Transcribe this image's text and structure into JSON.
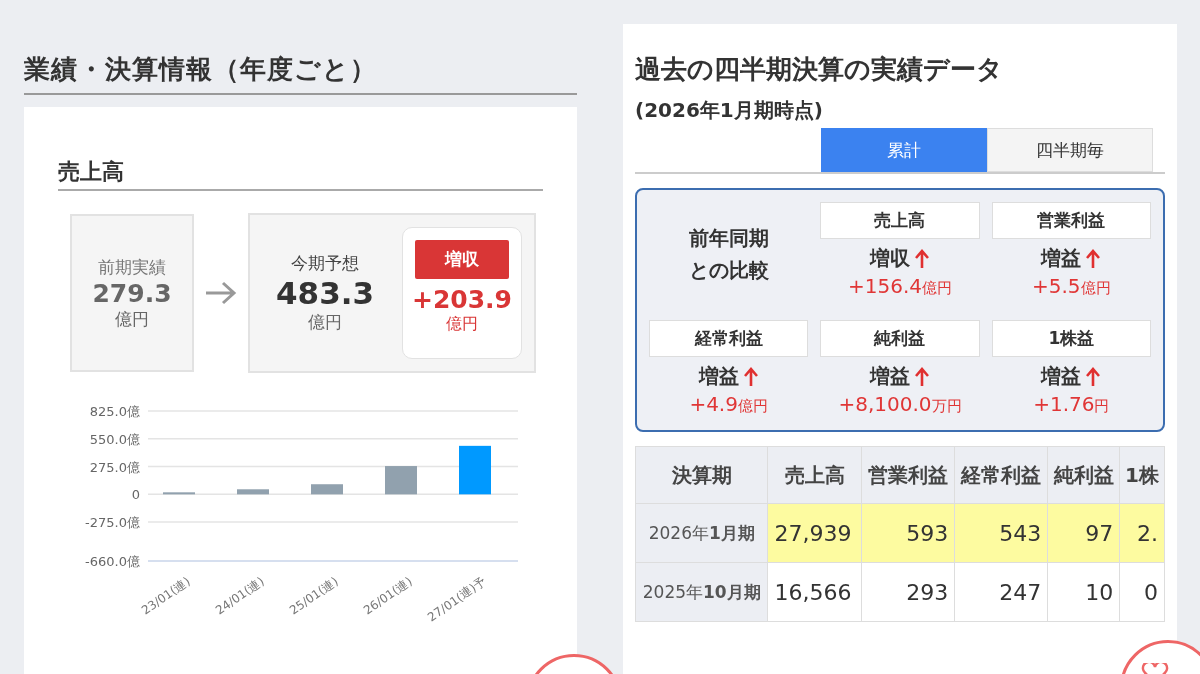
{
  "left": {
    "heading": "業績・決算情報（年度ごと）",
    "card": {
      "title": "売上高",
      "previous": {
        "label": "前期実績",
        "value": "279.3",
        "unit": "億円"
      },
      "forecast": {
        "label": "今期予想",
        "value": "483.3",
        "unit": "億円"
      },
      "change": {
        "badge": "増収",
        "value": "+203.9",
        "unit": "億円"
      },
      "chart_data": {
        "type": "bar",
        "categories": [
          "23/01(連)",
          "24/01(連)",
          "25/01(連)",
          "26/01(連)",
          "27/01(連)予"
        ],
        "series": [
          {
            "color": "#91a1ae",
            "values": [
              20,
              50,
              100,
              280,
              null
            ]
          },
          {
            "color": "#0099ff",
            "values": [
              null,
              null,
              null,
              null,
              480
            ]
          }
        ],
        "stacked": true,
        "grid": true,
        "ylim": [
          -660,
          825
        ],
        "yticks": [
          {
            "value": 825,
            "label": "825.0億"
          },
          {
            "value": 550,
            "label": "550.0億"
          },
          {
            "value": 275,
            "label": "275.0億"
          },
          {
            "value": 0,
            "label": "0"
          },
          {
            "value": -275,
            "label": "-275.0億"
          },
          {
            "value": -660,
            "label": "-660.0億"
          }
        ]
      }
    }
  },
  "right": {
    "heading": "過去の四半期決算の実績データ",
    "subheading": "(2026年1月期時点)",
    "tabs": [
      {
        "label": "累計",
        "selected": true
      },
      {
        "label": "四半期毎",
        "selected": false
      }
    ],
    "comparison": {
      "title": "前年同期との比較",
      "rows": [
        {
          "items": [
            {
              "label": "売上高",
              "result": "増収",
              "value": "+156.4",
              "unit": "億円"
            },
            {
              "label": "営業利益",
              "result": "増益",
              "value": "+5.5",
              "unit": "億円"
            }
          ]
        },
        {
          "items": [
            {
              "label": "経常利益",
              "result": "増益",
              "value": "+4.9",
              "unit": "億円"
            },
            {
              "label": "純利益",
              "result": "増益",
              "value": "+8,100.0",
              "unit": "万円"
            },
            {
              "label": "1株益",
              "result": "増益",
              "value": "+1.76",
              "unit": "円"
            }
          ]
        }
      ]
    },
    "table": {
      "columns": [
        "決算期",
        "売上高",
        "営業利益",
        "経常利益",
        "純利益",
        "1株"
      ],
      "rows": [
        {
          "highlighted": true,
          "cells": [
            "2026年**1月期**",
            "27,939",
            "593",
            "543",
            "97",
            "2."
          ]
        },
        {
          "highlighted": false,
          "cells": [
            "2025年**10月期**",
            "16,566",
            "293",
            "247",
            "10",
            "0"
          ]
        }
      ]
    }
  }
}
